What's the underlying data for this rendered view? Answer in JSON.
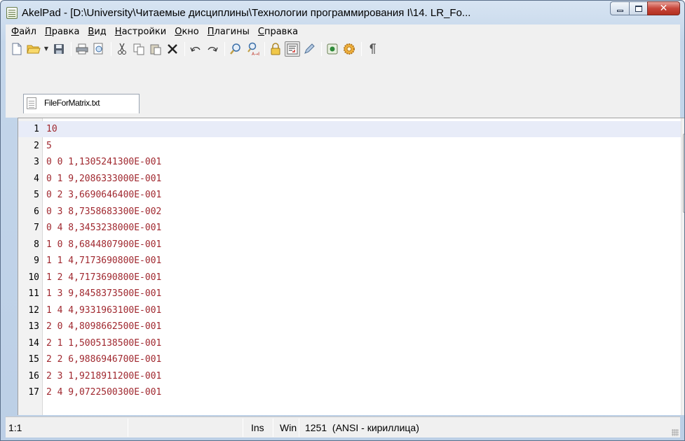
{
  "window": {
    "title": "AkelPad - [D:\\University\\Читаемые дисциплины\\Технологии программирования I\\14. LR_Fo..."
  },
  "menu": [
    "Файл",
    "Правка",
    "Вид",
    "Настройки",
    "Окно",
    "Плагины",
    "Справка"
  ],
  "toolbar": {
    "buttons": [
      "new-file",
      "open-file",
      "open-dropdown",
      "save",
      "print",
      "print-preview",
      "cut",
      "copy",
      "paste",
      "delete",
      "undo",
      "redo",
      "find",
      "replace",
      "read-only",
      "word-wrap",
      "insert-mode",
      "plugins",
      "settings",
      "show-special-chars"
    ]
  },
  "tab": {
    "label": "FileForMatrix.txt"
  },
  "editor": {
    "lines": [
      {
        "n": "1",
        "t": "10"
      },
      {
        "n": "2",
        "t": "5"
      },
      {
        "n": "3",
        "t": "0 0 1,1305241300E-001"
      },
      {
        "n": "4",
        "t": "0 1 9,2086333000E-001"
      },
      {
        "n": "5",
        "t": "0 2 3,6690646400E-001"
      },
      {
        "n": "6",
        "t": "0 3 8,7358683300E-002"
      },
      {
        "n": "7",
        "t": "0 4 8,3453238000E-001"
      },
      {
        "n": "8",
        "t": "1 0 8,6844807900E-001"
      },
      {
        "n": "9",
        "t": "1 1 4,7173690800E-001"
      },
      {
        "n": "10",
        "t": "1 2 4,7173690800E-001"
      },
      {
        "n": "11",
        "t": "1 3 9,8458373500E-001"
      },
      {
        "n": "12",
        "t": "1 4 4,9331963100E-001"
      },
      {
        "n": "13",
        "t": "2 0 4,8098662500E-001"
      },
      {
        "n": "14",
        "t": "2 1 1,5005138500E-001"
      },
      {
        "n": "15",
        "t": "2 2 6,9886946700E-001"
      },
      {
        "n": "16",
        "t": "2 3 1,9218911200E-001"
      },
      {
        "n": "17",
        "t": "2 4 9,0722500300E-001"
      }
    ],
    "text_color": "#a0282f"
  },
  "status": {
    "position": "1:1",
    "insert_mode": "Ins",
    "newline": "Win",
    "encoding": "1251  (ANSI - кириллица)"
  }
}
